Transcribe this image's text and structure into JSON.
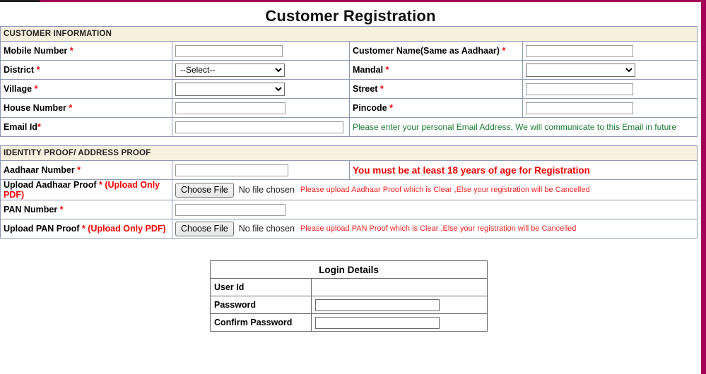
{
  "page": {
    "title": "Customer Registration",
    "accent_color": "#a30057",
    "section_header_bg": "#f7f0de"
  },
  "customer_information": {
    "section_title": "CUSTOMER INFORMATION",
    "fields": {
      "mobile_number": {
        "label": "Mobile Number",
        "required_mark": "*",
        "value": ""
      },
      "customer_name": {
        "label": "Customer Name(Same as Aadhaar)",
        "required_mark": "*",
        "value": ""
      },
      "district": {
        "label": "District",
        "required_mark": "*",
        "selected": "--Select--",
        "options": [
          "--Select--"
        ]
      },
      "mandal": {
        "label": "Mandal",
        "required_mark": "*",
        "selected": "",
        "options": [
          ""
        ]
      },
      "village": {
        "label": "Village",
        "required_mark": "*",
        "selected": "",
        "options": [
          ""
        ]
      },
      "street": {
        "label": "Street",
        "required_mark": "*",
        "value": ""
      },
      "house_number": {
        "label": "House Number",
        "required_mark": "*",
        "value": ""
      },
      "pincode": {
        "label": "Pincode",
        "required_mark": "*",
        "value": ""
      },
      "email_id": {
        "label": "Email Id",
        "required_mark": "*",
        "value": ""
      }
    },
    "email_hint": "Please enter your personal Email Address, We will communicate to this Email in future"
  },
  "identity_proof": {
    "section_title": "IDENTITY PROOF/ ADDRESS PROOF",
    "fields": {
      "aadhaar_number": {
        "label": "Aadhaar Number",
        "required_mark": "*",
        "value": ""
      },
      "upload_aadhaar_proof": {
        "label": "Upload Aadhaar Proof",
        "required_mark": "*",
        "format_note": "(Upload Only PDF)",
        "button_label": "Choose File",
        "file_status": "No file chosen",
        "warning": "Please upload Aadhaar Proof which is Clear ,Else your registration will be Cancelled"
      },
      "pan_number": {
        "label": "PAN Number",
        "required_mark": "*",
        "value": ""
      },
      "upload_pan_proof": {
        "label": "Upload PAN Proof",
        "required_mark": "*",
        "format_note": "(Upload Only PDF)",
        "button_label": "Choose File",
        "file_status": "No file chosen",
        "warning": "Please upload PAN Proof which is Clear ,Else your registration will be Cancelled"
      }
    },
    "age_warning": "You must be at least 18 years of age for Registration"
  },
  "login_details": {
    "title": "Login Details",
    "rows": {
      "user_id": {
        "label": "User Id",
        "value": ""
      },
      "password": {
        "label": "Password",
        "value": ""
      },
      "confirm_password": {
        "label": "Confirm Password",
        "value": ""
      }
    }
  }
}
